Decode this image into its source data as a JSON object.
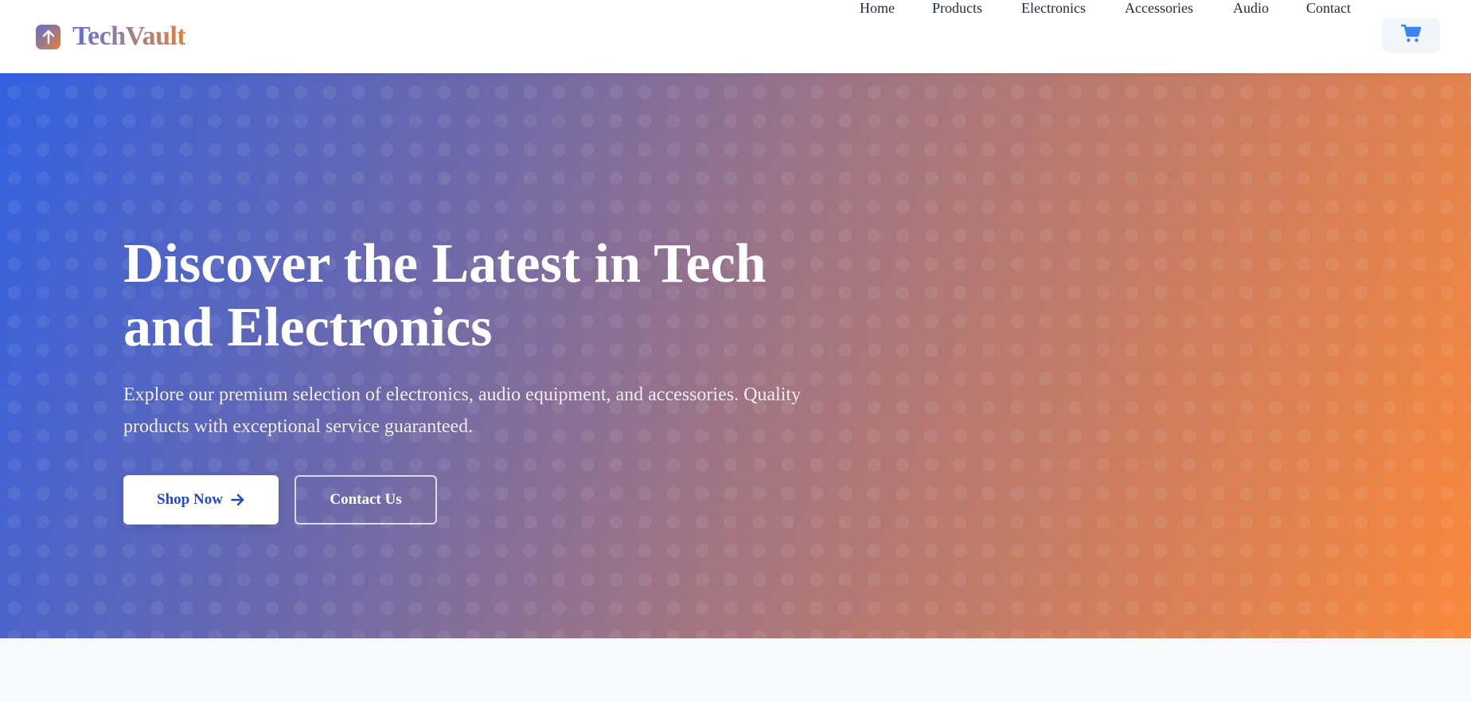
{
  "brand": {
    "name": "TechVault",
    "logo_icon": "arrow-up-icon"
  },
  "nav": {
    "items": [
      {
        "label": "Home"
      },
      {
        "label": "Products"
      },
      {
        "label": "Electronics"
      },
      {
        "label": "Accessories"
      },
      {
        "label": "Audio"
      },
      {
        "label": "Contact"
      }
    ],
    "cart_icon": "shopping-cart-icon"
  },
  "hero": {
    "title": "Discover the Latest in Tech and Electronics",
    "subtitle": "Explore our premium selection of electronics, audio equipment, and accessories. Quality products with exceptional service guaranteed.",
    "primary_button": "Shop Now",
    "primary_button_icon": "arrow-right-icon",
    "secondary_button": "Contact Us"
  },
  "colors": {
    "accent_blue": "#2646c9",
    "gradient_start": "#3361e0",
    "gradient_end": "#fa883a",
    "cart_icon": "#3b82f6",
    "nav_text": "#1f2a3d"
  }
}
